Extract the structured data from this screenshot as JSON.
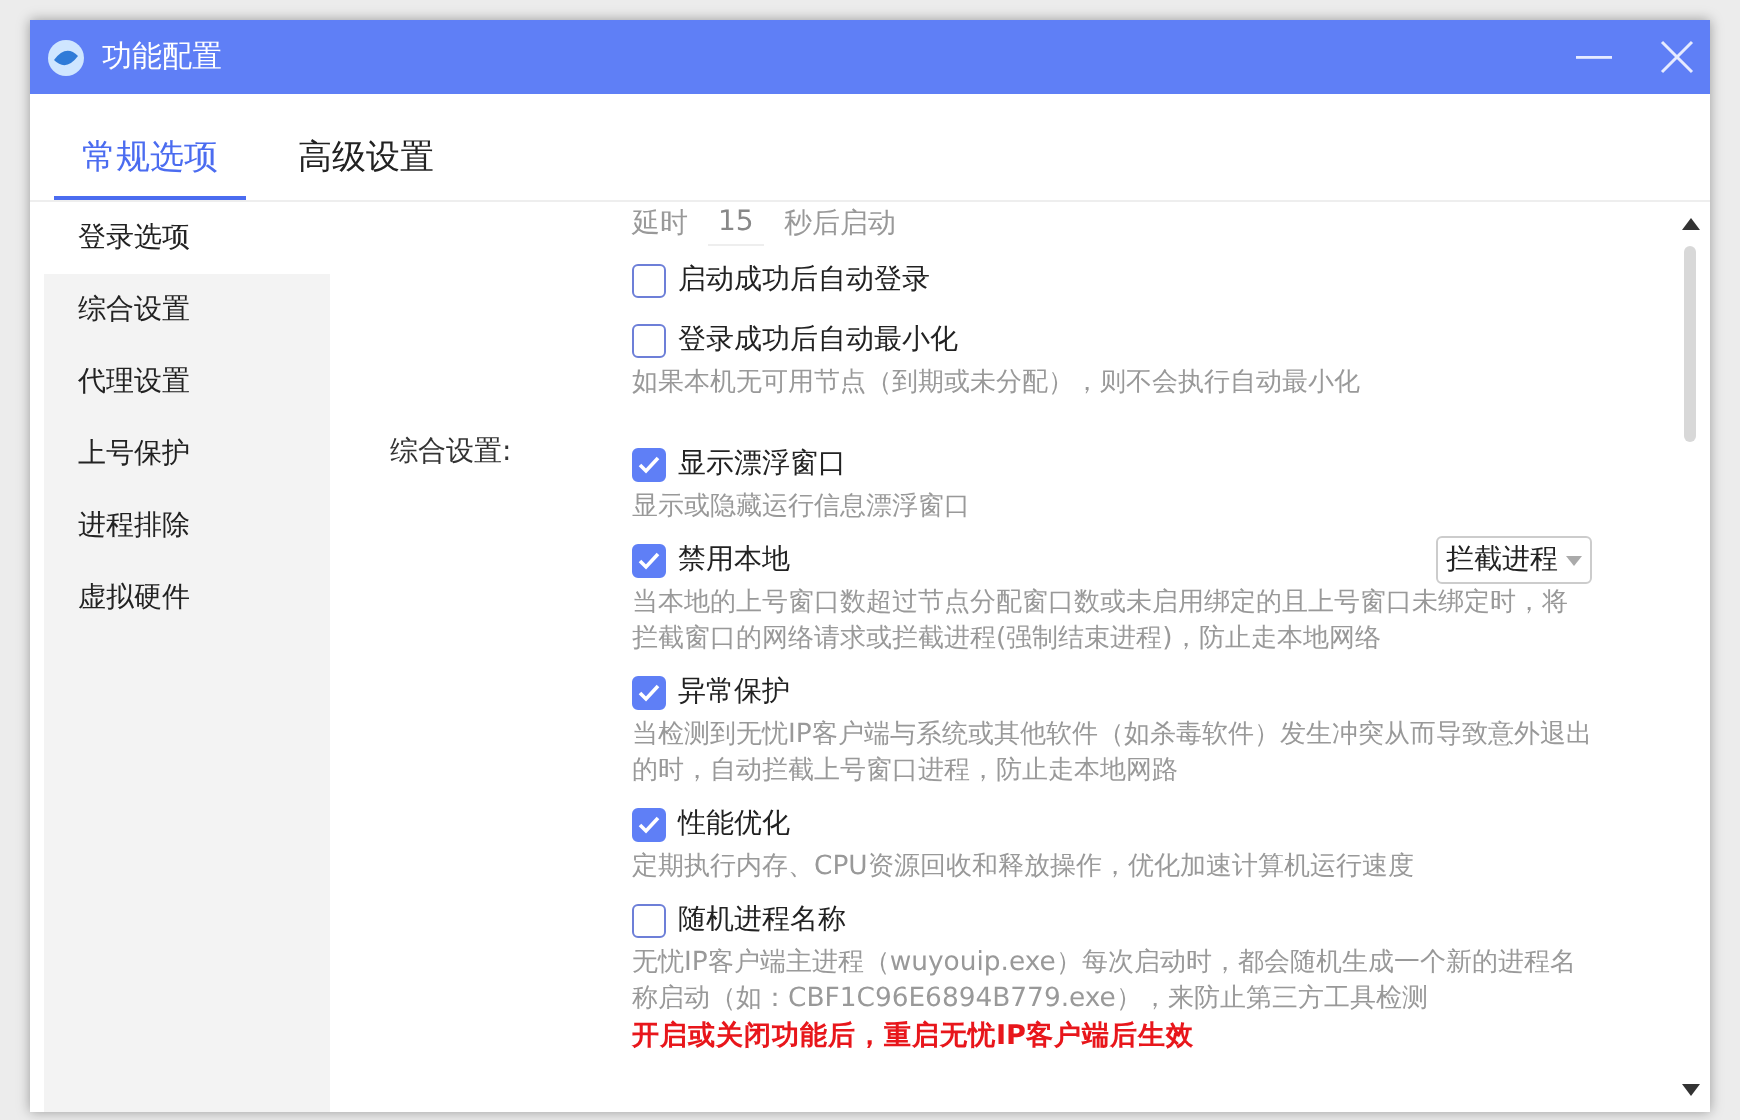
{
  "window": {
    "title": "功能配置"
  },
  "tabs": [
    {
      "label": "常规选项",
      "selected": true
    },
    {
      "label": "高级设置",
      "selected": false
    }
  ],
  "sidebar": {
    "items": [
      {
        "label": "登录选项",
        "selected": true
      },
      {
        "label": "综合设置",
        "selected": false
      },
      {
        "label": "代理设置",
        "selected": false
      },
      {
        "label": "上号保护",
        "selected": false
      },
      {
        "label": "进程排除",
        "selected": false
      },
      {
        "label": "虚拟硬件",
        "selected": false
      }
    ]
  },
  "delay": {
    "prefix": "延时",
    "value": "15",
    "suffix": "秒后启动"
  },
  "sections": [
    {
      "items": [
        {
          "label": "启动成功后自动登录",
          "checked": false
        },
        {
          "label": "登录成功后自动最小化",
          "checked": false,
          "description": "如果本机无可用节点（到期或未分配），则不会执行自动最小化"
        }
      ]
    },
    {
      "label": "综合设置:",
      "items": [
        {
          "label": "显示漂浮窗口",
          "checked": true,
          "description": "显示或隐藏运行信息漂浮窗口"
        },
        {
          "label": "禁用本地",
          "checked": true,
          "select": "拦截进程",
          "description": "当本地的上号窗口数超过节点分配窗口数或未启用绑定的且上号窗口未绑定时，将拦截窗口的网络请求或拦截进程(强制结束进程)，防止走本地网络"
        },
        {
          "label": "异常保护",
          "checked": true,
          "description": "当检测到无忧IP客户端与系统或其他软件（如杀毒软件）发生冲突从而导致意外退出的时，自动拦截上号窗口进程，防止走本地网路"
        },
        {
          "label": "性能优化",
          "checked": true,
          "description": "定期执行内存、CPU资源回收和释放操作，优化加速计算机运行速度"
        },
        {
          "label": "随机进程名称",
          "checked": false,
          "description": "无忧IP客户端主进程（wuyouip.exe）每次启动时，都会随机生成一个新的进程名称启动（如：CBF1C96E6894B779.exe），来防止第三方工具检测",
          "warning": "开启或关闭功能后，重启无忧IP客户端后生效"
        }
      ]
    }
  ]
}
